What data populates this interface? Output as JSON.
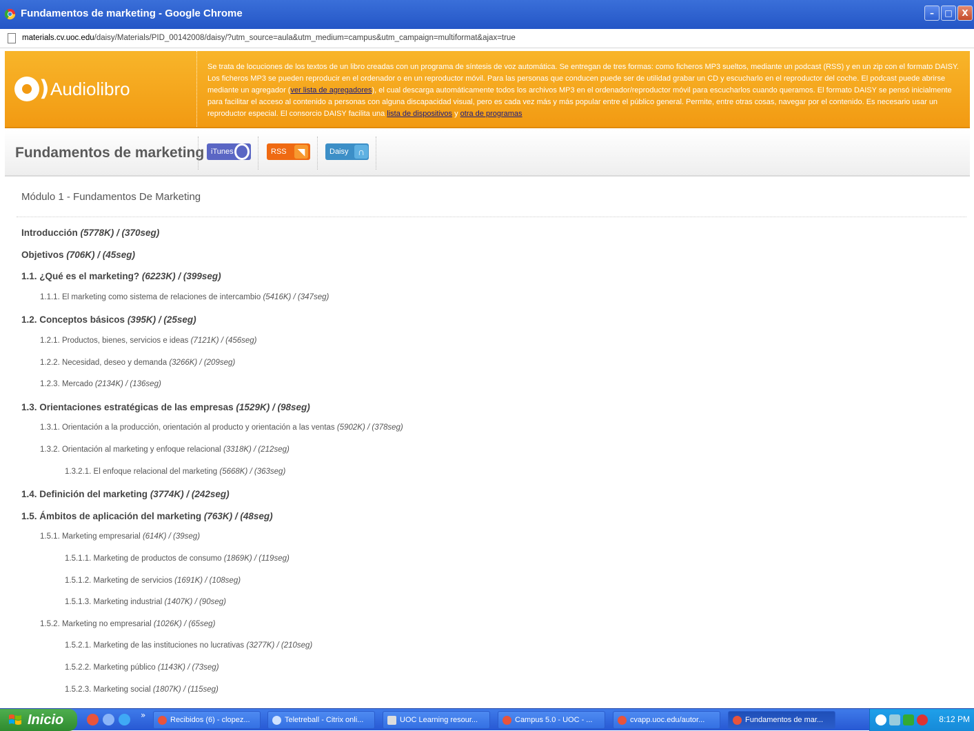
{
  "window": {
    "title": "Fundamentos de marketing - Google Chrome",
    "controls": [
      "–",
      "□",
      "X"
    ]
  },
  "address": {
    "host": "materials.cv.uoc.edu",
    "path": "/daisy/Materials/PID_00142008/daisy/?utm_source=aula&utm_medium=campus&utm_campaign=multiformat&ajax=true"
  },
  "banner": {
    "logo_text": "Audiolibro",
    "desc_part1": "Se trata de locuciones de los textos de un libro creadas con un programa de síntesis de voz automática. Se entregan de tres formas: como ficheros MP3 sueltos, mediante un podcast (RSS) y en un zip con el formato DAISY. Los ficheros MP3 se pueden reproducir en el ordenador o en un reproductor móvil. Para las personas que conducen puede ser de utilidad grabar un CD y escucharlo en el reproductor del coche. El podcast puede abrirse mediante un agregador (",
    "link_agregadores": "ver lista de agregadores",
    "desc_part2": "), el cual descarga automáticamente todos los archivos MP3 en el ordenador/reproductor móvil para escucharlos cuando queramos. El formato DAISY se pensó inicialmente para facilitar el acceso al contenido a personas con alguna discapacidad visual, pero es cada vez más y más popular entre el público general. Permite, entre otras cosas, navegar por el contenido. Es necesario usar un reproductor especial. El consorcio DAISY facilita una ",
    "link_dispositivos": "lista de dispositivos",
    "desc_part3": " y ",
    "link_programas": "otra de programas"
  },
  "header": {
    "book_title": "Fundamentos de marketing",
    "itunes_label": "iTunes",
    "rss_label": "RSS",
    "daisy_label": "Daisy"
  },
  "module_title": "Módulo 1 - Fundamentos De Marketing",
  "toc": [
    {
      "label": "Introducción ",
      "meta": "(5778K) / (370seg)",
      "level": 0
    },
    {
      "label": "Objetivos ",
      "meta": "(706K) / (45seg)",
      "level": 0
    },
    {
      "label": "1.1. ¿Qué es el marketing? ",
      "meta": "(6223K) / (399seg)",
      "level": 0
    },
    {
      "label": "1.1.1. El marketing como sistema de relaciones de intercambio ",
      "meta": "(5416K) / (347seg)",
      "level": 1
    },
    {
      "label": "1.2. Conceptos básicos ",
      "meta": "(395K) / (25seg)",
      "level": 0
    },
    {
      "label": "1.2.1. Productos, bienes, servicios e ideas ",
      "meta": "(7121K) / (456seg)",
      "level": 1
    },
    {
      "label": "1.2.2. Necesidad, deseo y demanda ",
      "meta": "(3266K) / (209seg)",
      "level": 1
    },
    {
      "label": "1.2.3. Mercado ",
      "meta": "(2134K) / (136seg)",
      "level": 1
    },
    {
      "label": "1.3. Orientaciones estratégicas de las empresas ",
      "meta": "(1529K) / (98seg)",
      "level": 0
    },
    {
      "label": "1.3.1. Orientación a la producción, orientación al producto y orientación a las ventas ",
      "meta": "(5902K) / (378seg)",
      "level": 1
    },
    {
      "label": "1.3.2. Orientación al marketing y enfoque relacional ",
      "meta": "(3318K) / (212seg)",
      "level": 1
    },
    {
      "label": "1.3.2.1. El enfoque relacional del marketing ",
      "meta": "(5668K) / (363seg)",
      "level": 2
    },
    {
      "label": "1.4. Definición del marketing ",
      "meta": "(3774K) / (242seg)",
      "level": 0
    },
    {
      "label": "1.5. Ámbitos de aplicación del marketing ",
      "meta": "(763K) / (48seg)",
      "level": 0
    },
    {
      "label": "1.5.1. Marketing empresarial ",
      "meta": "(614K) / (39seg)",
      "level": 1
    },
    {
      "label": "1.5.1.1. Marketing de productos de consumo ",
      "meta": "(1869K) / (119seg)",
      "level": 2
    },
    {
      "label": "1.5.1.2. Marketing de servicios ",
      "meta": "(1691K) / (108seg)",
      "level": 2
    },
    {
      "label": "1.5.1.3. Marketing industrial ",
      "meta": "(1407K) / (90seg)",
      "level": 2
    },
    {
      "label": "1.5.2. Marketing no empresarial ",
      "meta": "(1026K) / (65seg)",
      "level": 1
    },
    {
      "label": "1.5.2.1. Marketing de las instituciones no lucrativas ",
      "meta": "(3277K) / (210seg)",
      "level": 2
    },
    {
      "label": "1.5.2.2. Marketing público ",
      "meta": "(1143K) / (73seg)",
      "level": 2
    },
    {
      "label": "1.5.2.3. Marketing social ",
      "meta": "(1807K) / (115seg)",
      "level": 2
    }
  ],
  "taskbar": {
    "start_label": "Inicio",
    "tasks": [
      "Recibidos (6) - clopez...",
      "Teletreball - Citrix onli...",
      "UOC Learning resour...",
      "Campus 5.0 - UOC - ...",
      "cvapp.uoc.edu/autor...",
      "Fundamentos de mar..."
    ],
    "clock": "8:12 PM"
  },
  "colors": {
    "banner_orange": "#f29a12",
    "itunes_blue": "#5a66c4",
    "rss_orange": "#ef6a12",
    "daisy_blue": "#3c8fc7",
    "xp_taskbar": "#2758d3",
    "xp_start": "#2f8b2f"
  }
}
